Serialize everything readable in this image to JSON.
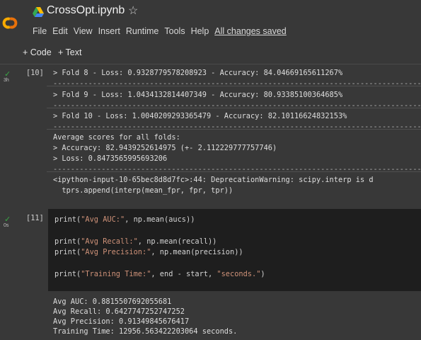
{
  "header": {
    "title": "CrossOpt.ipynb",
    "menu": [
      "File",
      "Edit",
      "View",
      "Insert",
      "Runtime",
      "Tools",
      "Help"
    ],
    "saved_status": "All changes saved"
  },
  "toolbar": {
    "add_code": "+ Code",
    "add_text": "+ Text"
  },
  "cells": [
    {
      "exec_count": "[10]",
      "runtime": "3h",
      "output": {
        "folds": [
          "> Fold 8 - Loss: 0.9328779578208923 - Accuracy: 84.04669165611267%",
          "> Fold 9 - Loss: 1.0434132814407349 - Accuracy: 80.93385100364685%",
          "> Fold 10 - Loss: 1.0040209293365479 - Accuracy: 82.10116624832153%"
        ],
        "dashes": "---------------------------------------------------------------------------------------------",
        "avg_header": "Average scores for all folds:",
        "avg_accuracy": "> Accuracy: 82.9439252614975 (+- 2.112229777757746)",
        "avg_loss": "> Loss: 0.8473565995693206",
        "warning": "<ipython-input-10-65bec8d8d7fc>:44: DeprecationWarning: scipy.interp is d",
        "warning_cont": "  tprs.append(interp(mean_fpr, fpr, tpr))"
      }
    },
    {
      "exec_count": "[11]",
      "runtime": "0s",
      "code": {
        "l1_pre": "print(",
        "l1_str": "\"Avg AUC:\"",
        "l1_post": ", np.mean(aucs))",
        "l2_pre": "print(",
        "l2_str": "\"Avg Recall:\"",
        "l2_post": ", np.mean(recall))",
        "l3_pre": "print(",
        "l3_str": "\"Avg Precision:\"",
        "l3_post": ", np.mean(precision))",
        "l4_pre": "print(",
        "l4_str": "\"Training Time:\"",
        "l4_mid": ", end - start, ",
        "l4_str2": "\"seconds.\"",
        "l4_post": ")"
      },
      "output": [
        "Avg AUC: 0.8815507692055681",
        "Avg Recall: 0.6427747252747252",
        "Avg Precision: 0.91349845676417",
        "Training Time: 12956.563422203064 seconds."
      ]
    }
  ],
  "colors": {
    "background": "#383838",
    "code_bg": "#1e1e1e",
    "string": "#ce9178",
    "check": "#39a845"
  }
}
